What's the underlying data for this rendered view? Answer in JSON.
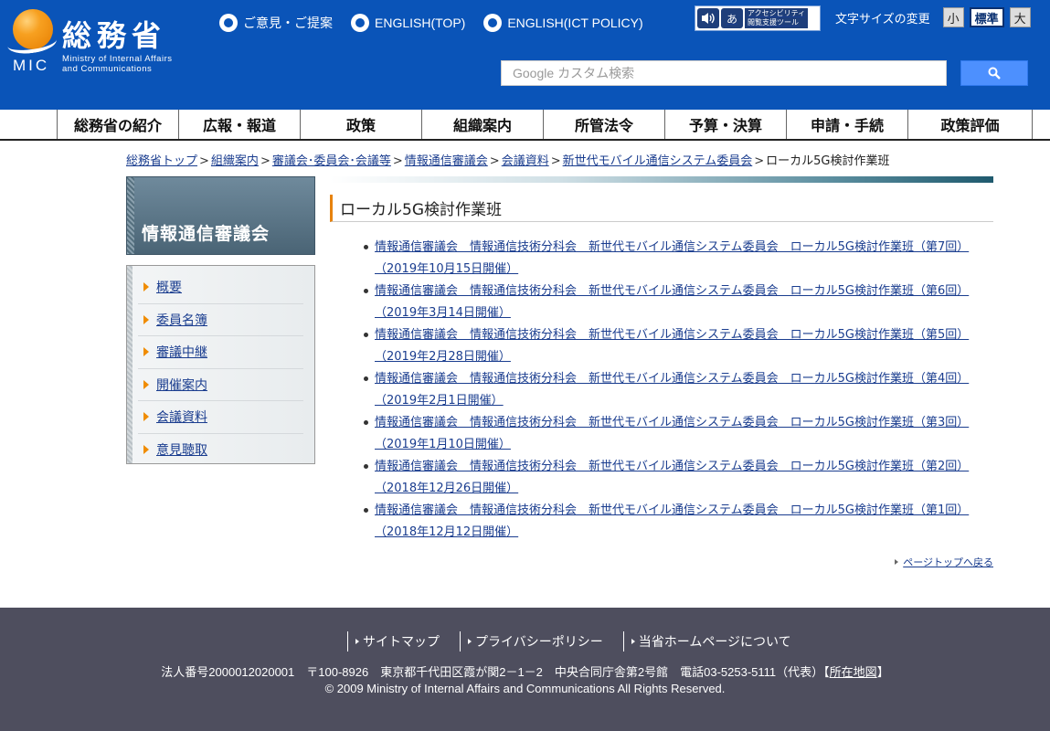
{
  "header": {
    "logo_jp": "総務省",
    "logo_mic": "MIC",
    "logo_en_line1": "Ministry of Internal Affairs",
    "logo_en_line2": "and Communications",
    "toplinks": [
      "ご意見・ご提案",
      "ENGLISH(TOP)",
      "ENGLISH(ICT POLICY)"
    ],
    "access_tool_line1": "アクセシビリティ",
    "access_tool_line2": "閲覧支援ツール",
    "access_icon_text": "あ",
    "fontsize_label": "文字サイズの変更",
    "fontsize_options": [
      "小",
      "標準",
      "大"
    ],
    "search_google": "Google",
    "search_placeholder": "カスタム検索"
  },
  "gnav": {
    "items": [
      "総務省の紹介",
      "広報・報道",
      "政策",
      "組織案内",
      "所管法令",
      "予算・決算",
      "申請・手続",
      "政策評価"
    ]
  },
  "breadcrumb": {
    "links": [
      "総務省トップ",
      "組織案内",
      "審議会･委員会･会議等",
      "情報通信審議会",
      "会議資料",
      "新世代モバイル通信システム委員会"
    ],
    "current": "ローカル5G検討作業班",
    "separator": ">"
  },
  "sidebar": {
    "title": "情報通信審議会",
    "items": [
      "概要",
      "委員名簿",
      "審議中継",
      "開催案内",
      "会議資料",
      "意見聴取"
    ]
  },
  "main": {
    "title": "ローカル5G検討作業班",
    "meetings": [
      {
        "line1": "情報通信審議会　情報通信技術分科会　新世代モバイル通信システム委員会　ローカル5G検討作業班（第7回）",
        "line2": "（2019年10月15日開催）"
      },
      {
        "line1": "情報通信審議会　情報通信技術分科会　新世代モバイル通信システム委員会　ローカル5G検討作業班（第6回）",
        "line2": "（2019年3月14日開催）"
      },
      {
        "line1": "情報通信審議会　情報通信技術分科会　新世代モバイル通信システム委員会　ローカル5G検討作業班（第5回）",
        "line2": "（2019年2月28日開催）"
      },
      {
        "line1": "情報通信審議会　情報通信技術分科会　新世代モバイル通信システム委員会　ローカル5G検討作業班（第4回）",
        "line2": "（2019年2月1日開催）"
      },
      {
        "line1": "情報通信審議会　情報通信技術分科会　新世代モバイル通信システム委員会　ローカル5G検討作業班（第3回）",
        "line2": "（2019年1月10日開催）"
      },
      {
        "line1": "情報通信審議会　情報通信技術分科会　新世代モバイル通信システム委員会　ローカル5G検討作業班（第2回）",
        "line2": "（2018年12月26日開催）"
      },
      {
        "line1": "情報通信審議会　情報通信技術分科会　新世代モバイル通信システム委員会　ローカル5G検討作業班（第1回）",
        "line2": "（2018年12月12日開催）"
      }
    ],
    "pagetop": "ページトップへ戻る"
  },
  "footer": {
    "links": [
      "サイトマップ",
      "プライバシーポリシー",
      "当省ホームページについて"
    ],
    "address": "法人番号2000012020001　〒100-8926　東京都千代田区霞が関2－1－2　中央合同庁舎第2号館　電話03-5253-5111（代表）【",
    "map_link": "所在地図",
    "address_end": "】",
    "copyright": "© 2009 Ministry of Internal Affairs and Communications All Rights Reserved."
  },
  "colors": {
    "header_bg": "#0a54b8",
    "footer_bg": "#4e4e5e",
    "accent_orange": "#e7830f",
    "link": "#1a3d8f"
  }
}
